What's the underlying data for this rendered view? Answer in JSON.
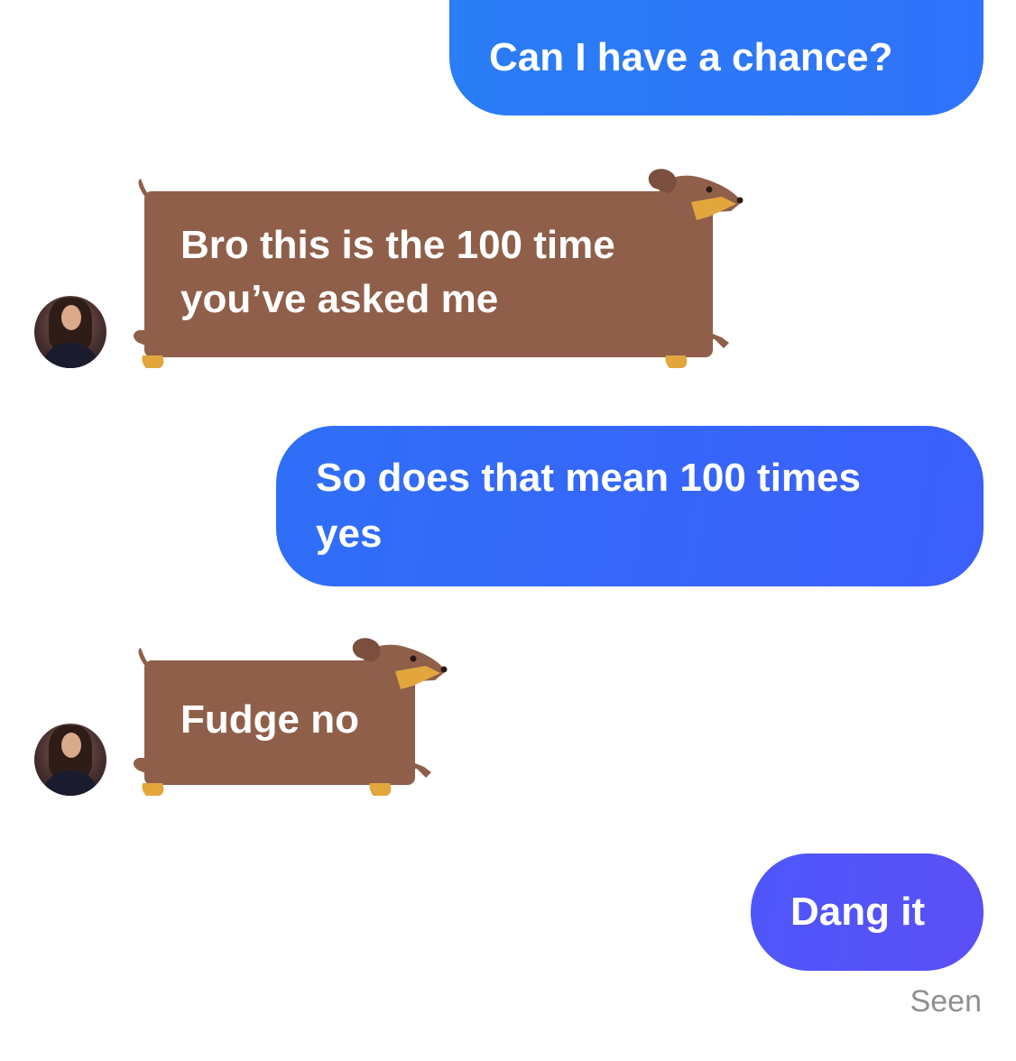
{
  "messages": [
    {
      "from": "me",
      "text": "Can I have a chance?"
    },
    {
      "from": "them",
      "text_lines": [
        "Bro this is the 100 time",
        "you’ve asked me"
      ]
    },
    {
      "from": "me",
      "text_lines": [
        "So does that mean 100 times",
        "yes"
      ]
    },
    {
      "from": "them",
      "text": "Fudge no"
    },
    {
      "from": "me",
      "text": "Dang it"
    }
  ],
  "receipt": "Seen",
  "colors": {
    "outgoing_bubble_start": "#2a7df5",
    "outgoing_bubble_end": "#5b4ff7",
    "dog_bubble": "#8f5f4a",
    "dog_snout": "#e2a63c",
    "receipt_text": "#8e8e93"
  },
  "icons": {
    "incoming_bubble_theme": "dachshund-icon",
    "sender_avatar": "avatar-photo"
  }
}
